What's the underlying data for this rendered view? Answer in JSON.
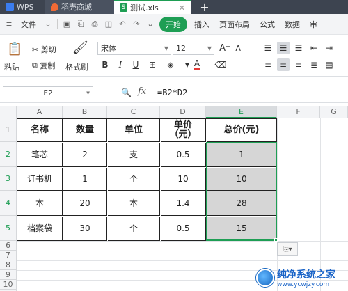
{
  "titlebar": {
    "tabs": [
      {
        "label": "WPS",
        "icon": "wps-icon"
      },
      {
        "label": "稻壳商城",
        "icon": "daoke-icon"
      },
      {
        "label": "测试.xls",
        "icon": "sheet-icon",
        "icon_glyph": "S",
        "active": true
      }
    ],
    "close_glyph": "✕",
    "add_glyph": "+"
  },
  "menubar": {
    "file_label": "文件",
    "items": [
      "开始",
      "插入",
      "页面布局",
      "公式",
      "数据",
      "审"
    ]
  },
  "ribbon": {
    "paste": "粘贴",
    "cut": "剪切",
    "copy": "复制",
    "format_painter": "格式刷",
    "font_name": "宋体",
    "font_size": "12",
    "bold": "B",
    "italic": "I",
    "underline": "U",
    "font_color_glyph": "A",
    "grow_font": "A⁺",
    "shrink_font": "A⁻"
  },
  "formula_bar": {
    "name_box": "E2",
    "fx": "fx",
    "formula": "=B2*D2"
  },
  "columns": [
    "A",
    "B",
    "C",
    "D",
    "E",
    "F",
    "G"
  ],
  "rows": [
    "1",
    "2",
    "3",
    "4",
    "5",
    "6",
    "7",
    "8",
    "9",
    "10",
    "11"
  ],
  "table": {
    "headers": [
      "名称",
      "数量",
      "单位",
      "单价\n（元）",
      "总价(元)"
    ],
    "rows": [
      [
        "笔芯",
        "2",
        "支",
        "0.5",
        "1"
      ],
      [
        "订书机",
        "1",
        "个",
        "10",
        "10"
      ],
      [
        "本",
        "20",
        "本",
        "1.4",
        "28"
      ],
      [
        "档案袋",
        "30",
        "个",
        "0.5",
        "15"
      ]
    ]
  },
  "paste_options_glyph": "⎘▾",
  "watermark": {
    "title": "纯净系统之家",
    "url": "www.ycwjzy.com"
  },
  "colors": {
    "accent": "#1e9e54",
    "titlebar": "#3d4450",
    "selection_fill": "#d6d6d6"
  }
}
